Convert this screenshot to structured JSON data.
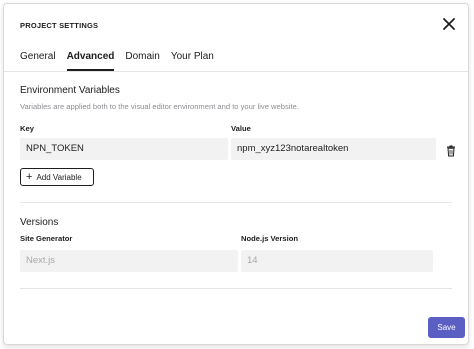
{
  "dialog": {
    "title": "PROJECT SETTINGS",
    "close_icon": "close-icon"
  },
  "tabs": [
    {
      "label": "General"
    },
    {
      "label": "Advanced",
      "active": true
    },
    {
      "label": "Domain"
    },
    {
      "label": "Your Plan"
    }
  ],
  "env": {
    "heading": "Environment Variables",
    "hint": "Variables are applied both to the visual editor environment and to your live website.",
    "key_label": "Key",
    "value_label": "Value",
    "rows": [
      {
        "key": "NPN_TOKEN",
        "value": "npm_xyz123notarealtoken"
      }
    ],
    "add_label": "Add Variable",
    "trash_icon": "trash-icon"
  },
  "versions": {
    "heading": "Versions",
    "generator_label": "Site Generator",
    "generator_value": "Next.js",
    "node_label": "Node.js Version",
    "node_value": "14"
  },
  "footer": {
    "save_label": "Save"
  },
  "colors": {
    "accent": "#5b5ec2",
    "field_bg": "#f2f2f2",
    "muted_text": "#8e8e93"
  }
}
